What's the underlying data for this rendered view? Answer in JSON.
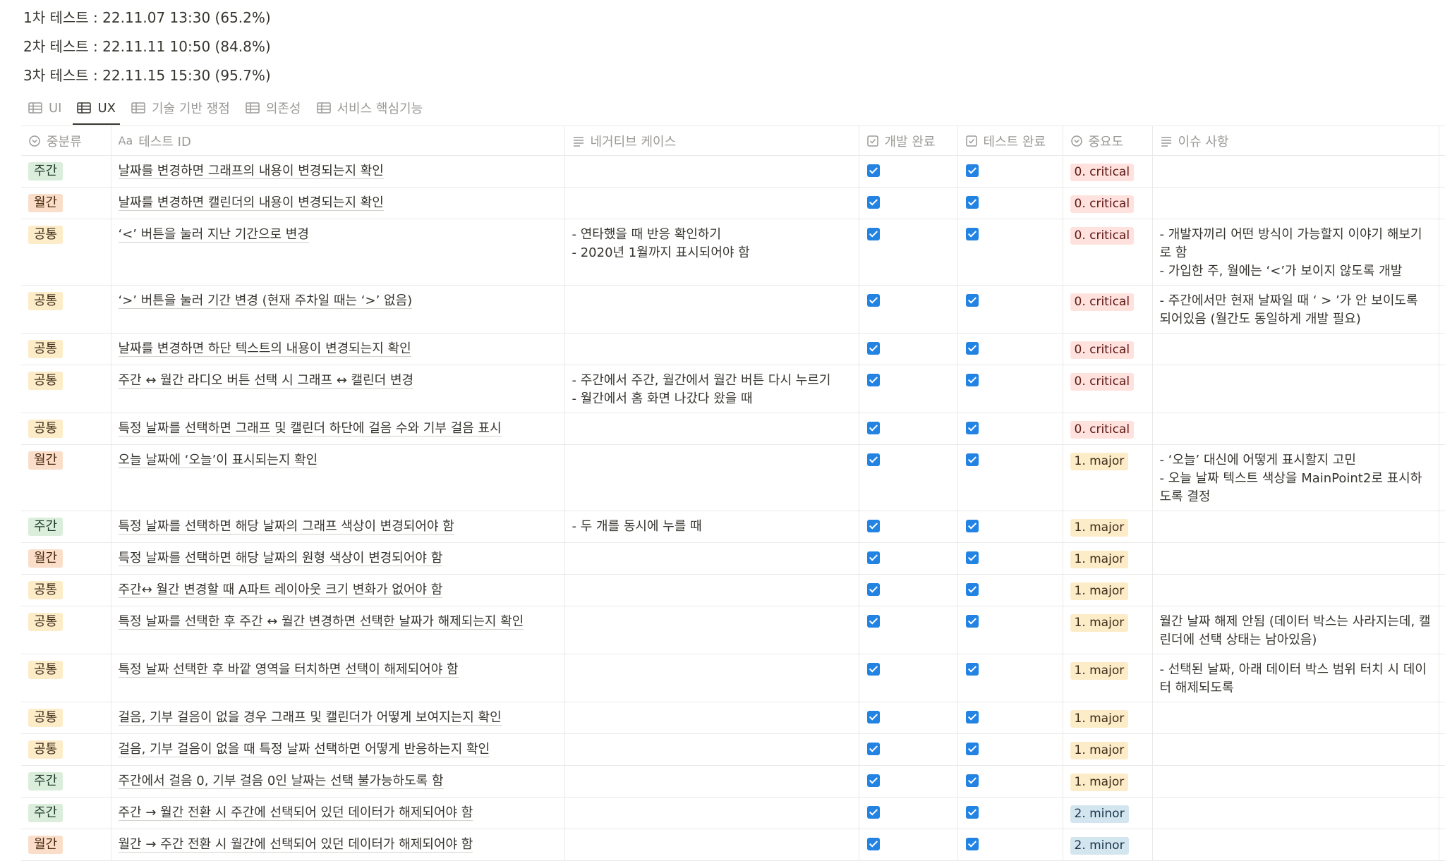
{
  "summary": {
    "lines": [
      "1차 테스트 : 22.11.07 13:30 (65.2%)",
      "2차 테스트 : 22.11.11 10:50 (84.8%)",
      "3차 테스트 : 22.11.15 15:30 (95.7%)"
    ]
  },
  "views": {
    "tabs": [
      {
        "label": "UI",
        "icon": "table-icon",
        "active": false
      },
      {
        "label": "UX",
        "icon": "table-icon",
        "active": true
      },
      {
        "label": "기술 기반 쟁점",
        "icon": "table-icon",
        "active": false
      },
      {
        "label": "의존성",
        "icon": "table-icon",
        "active": false
      },
      {
        "label": "서비스 핵심기능",
        "icon": "table-icon",
        "active": false
      }
    ]
  },
  "columns": {
    "category": {
      "label": "중분류",
      "icon": "select-icon"
    },
    "test_id": {
      "label": "테스트 ID",
      "icon": "title-icon",
      "icon_text": "Aa"
    },
    "negative": {
      "label": "네거티브 케이스",
      "icon": "text-icon"
    },
    "dev_done": {
      "label": "개발 완료",
      "icon": "checkbox-icon"
    },
    "test_done": {
      "label": "테스트 완료",
      "icon": "checkbox-icon"
    },
    "priority": {
      "label": "중요도",
      "icon": "select-icon"
    },
    "issue": {
      "label": "이슈 사항",
      "icon": "text-icon"
    }
  },
  "colors": {
    "checkbox": "#2383e2",
    "tag_jugan": "#dbeddb",
    "tag_wolgan": "#fadec9",
    "tag_gongtong": "#fdecc8",
    "priority_critical": "#ffe2dd",
    "priority_major": "#fdecc8",
    "priority_minor": "#d3e5ef"
  },
  "rows": [
    {
      "category": "주간",
      "tag": "jugan",
      "name": "날짜를 변경하면 그래프의 내용이 변경되는지 확인",
      "negative": "",
      "dev_done": true,
      "test_done": true,
      "priority": "0. critical",
      "level": "critical",
      "issue": ""
    },
    {
      "category": "월간",
      "tag": "wolgan",
      "name": "날짜를 변경하면 캘린더의 내용이 변경되는지 확인",
      "negative": "",
      "dev_done": true,
      "test_done": true,
      "priority": "0. critical",
      "level": "critical",
      "issue": ""
    },
    {
      "category": "공통",
      "tag": "gongtong",
      "name": "‘<’ 버튼을 눌러 지난 기간으로 변경",
      "negative": "- 연타했을 때 반응 확인하기\n- 2020년 1월까지 표시되어야 함",
      "dev_done": true,
      "test_done": true,
      "priority": "0. critical",
      "level": "critical",
      "issue": "- 개발자끼리 어떤 방식이 가능할지 이야기 해보기로 함\n- 가입한 주, 월에는 ‘<’가 보이지 않도록 개발"
    },
    {
      "category": "공통",
      "tag": "gongtong",
      "name": "‘>’ 버튼을 눌러 기간 변경 (현재 주차일 때는 ‘>’ 없음)",
      "negative": "",
      "dev_done": true,
      "test_done": true,
      "priority": "0. critical",
      "level": "critical",
      "issue": "- 주간에서만 현재 날짜일 때 ‘ > ’가 안 보이도록 되어있음 (월간도 동일하게 개발 필요)"
    },
    {
      "category": "공통",
      "tag": "gongtong",
      "name": "날짜를 변경하면 하단 텍스트의 내용이 변경되는지 확인",
      "negative": "",
      "dev_done": true,
      "test_done": true,
      "priority": "0. critical",
      "level": "critical",
      "issue": ""
    },
    {
      "category": "공통",
      "tag": "gongtong",
      "name": "주간 ↔ 월간 라디오 버튼 선택 시 그래프 ↔ 캘린더 변경",
      "negative": "- 주간에서 주간, 월간에서 월간 버튼 다시 누르기\n- 월간에서 홈 화면 나갔다 왔을 때",
      "dev_done": true,
      "test_done": true,
      "priority": "0. critical",
      "level": "critical",
      "issue": ""
    },
    {
      "category": "공통",
      "tag": "gongtong",
      "name": "특정 날짜를 선택하면 그래프 및 캘린더 하단에 걸음 수와 기부 걸음 표시",
      "negative": "",
      "dev_done": true,
      "test_done": true,
      "priority": "0. critical",
      "level": "critical",
      "issue": ""
    },
    {
      "category": "월간",
      "tag": "wolgan",
      "name": "오늘 날짜에 ‘오늘’이 표시되는지 확인",
      "negative": "",
      "dev_done": true,
      "test_done": true,
      "priority": "1. major",
      "level": "major",
      "issue": "- ‘오늘’ 대신에 어떻게 표시할지 고민\n- 오늘 날짜 텍스트 색상을 MainPoint2로 표시하도록 결정"
    },
    {
      "category": "주간",
      "tag": "jugan",
      "name": "특정 날짜를 선택하면 해당 날짜의 그래프 색상이 변경되어야 함",
      "negative": "- 두 개를 동시에 누를 때",
      "dev_done": true,
      "test_done": true,
      "priority": "1. major",
      "level": "major",
      "issue": ""
    },
    {
      "category": "월간",
      "tag": "wolgan",
      "name": "특정 날짜를 선택하면 해당 날짜의 원형 색상이 변경되어야 함",
      "negative": "",
      "dev_done": true,
      "test_done": true,
      "priority": "1. major",
      "level": "major",
      "issue": ""
    },
    {
      "category": "공통",
      "tag": "gongtong",
      "name": "주간↔ 월간 변경할 때 A파트 레이아웃 크기 변화가 없어야 함",
      "negative": "",
      "dev_done": true,
      "test_done": true,
      "priority": "1. major",
      "level": "major",
      "issue": ""
    },
    {
      "category": "공통",
      "tag": "gongtong",
      "name": "특정 날짜를 선택한 후 주간 ↔ 월간 변경하면 선택한 날짜가 해제되는지 확인",
      "negative": "",
      "dev_done": true,
      "test_done": true,
      "priority": "1. major",
      "level": "major",
      "issue": "월간 날짜 해제 안됨 (데이터 박스는 사라지는데, 캘린더에 선택 상태는 남아있음)"
    },
    {
      "category": "공통",
      "tag": "gongtong",
      "name": "특정 날짜 선택한 후 바깥 영역을 터치하면 선택이 해제되어야 함",
      "negative": "",
      "dev_done": true,
      "test_done": true,
      "priority": "1. major",
      "level": "major",
      "issue": "- 선택된 날짜, 아래 데이터 박스 범위 터치 시 데이터 해제되도록"
    },
    {
      "category": "공통",
      "tag": "gongtong",
      "name": "걸음, 기부 걸음이 없을 경우 그래프 및 캘린더가 어떻게 보여지는지 확인",
      "negative": "",
      "dev_done": true,
      "test_done": true,
      "priority": "1. major",
      "level": "major",
      "issue": ""
    },
    {
      "category": "공통",
      "tag": "gongtong",
      "name": "걸음, 기부 걸음이 없을 때 특정 날짜 선택하면 어떻게 반응하는지 확인",
      "negative": "",
      "dev_done": true,
      "test_done": true,
      "priority": "1. major",
      "level": "major",
      "issue": ""
    },
    {
      "category": "주간",
      "tag": "jugan",
      "name": "주간에서 걸음 0, 기부 걸음 0인 날짜는 선택 불가능하도록 함",
      "negative": "",
      "dev_done": true,
      "test_done": true,
      "priority": "1. major",
      "level": "major",
      "issue": ""
    },
    {
      "category": "주간",
      "tag": "jugan",
      "name": "주간 → 월간 전환 시 주간에 선택되어 있던 데이터가 해제되어야 함",
      "negative": "",
      "dev_done": true,
      "test_done": true,
      "priority": "2. minor",
      "level": "minor",
      "issue": ""
    },
    {
      "category": "월간",
      "tag": "wolgan",
      "name": "월간 → 주간 전환 시 월간에 선택되어 있던 데이터가 해제되어야 함",
      "negative": "",
      "dev_done": true,
      "test_done": true,
      "priority": "2. minor",
      "level": "minor",
      "issue": ""
    }
  ]
}
